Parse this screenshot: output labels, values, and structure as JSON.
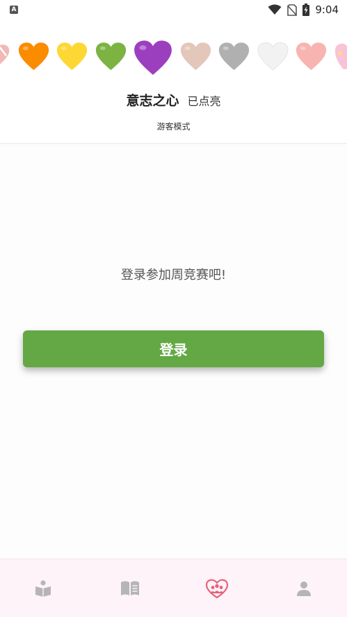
{
  "status_bar": {
    "app_indicator": "A",
    "time": "9:04",
    "icons": [
      "wifi-icon",
      "no-sim-icon",
      "battery-charging-icon"
    ]
  },
  "hearts": [
    {
      "name": "heart-partial-left-icon",
      "color": "#f2b9b4"
    },
    {
      "name": "orange-heart-icon",
      "color": "#fb8c00"
    },
    {
      "name": "yellow-heart-icon",
      "color": "#fdd835"
    },
    {
      "name": "green-heart-icon",
      "color": "#7cb342"
    },
    {
      "name": "purple-heart-icon",
      "color": "#9c3fbf",
      "selected": true
    },
    {
      "name": "beige-heart-icon",
      "color": "#e3c7bb"
    },
    {
      "name": "gray-heart-icon",
      "color": "#b0b0b0"
    },
    {
      "name": "white-heart-icon",
      "color": "#f2f2f2"
    },
    {
      "name": "pink-heart-icon",
      "color": "#f7b4b0"
    },
    {
      "name": "sparkling-heart-partial-icon",
      "color": "#f8c3d8"
    }
  ],
  "header": {
    "title": "意志之心",
    "status": "已点亮",
    "mode": "游客模式"
  },
  "main": {
    "prompt": "登录参加周竞赛吧!",
    "login_button": "登录"
  },
  "bottom_nav": {
    "items": [
      {
        "name": "nav-reading-icon",
        "active": false
      },
      {
        "name": "nav-book-icon",
        "active": false
      },
      {
        "name": "nav-community-icon",
        "active": true
      },
      {
        "name": "nav-profile-icon",
        "active": false
      }
    ]
  },
  "colors": {
    "accent_green": "#63a844",
    "nav_active": "#e8617a",
    "nav_inactive": "#b5b5b5",
    "nav_background": "#fdf3f8"
  }
}
